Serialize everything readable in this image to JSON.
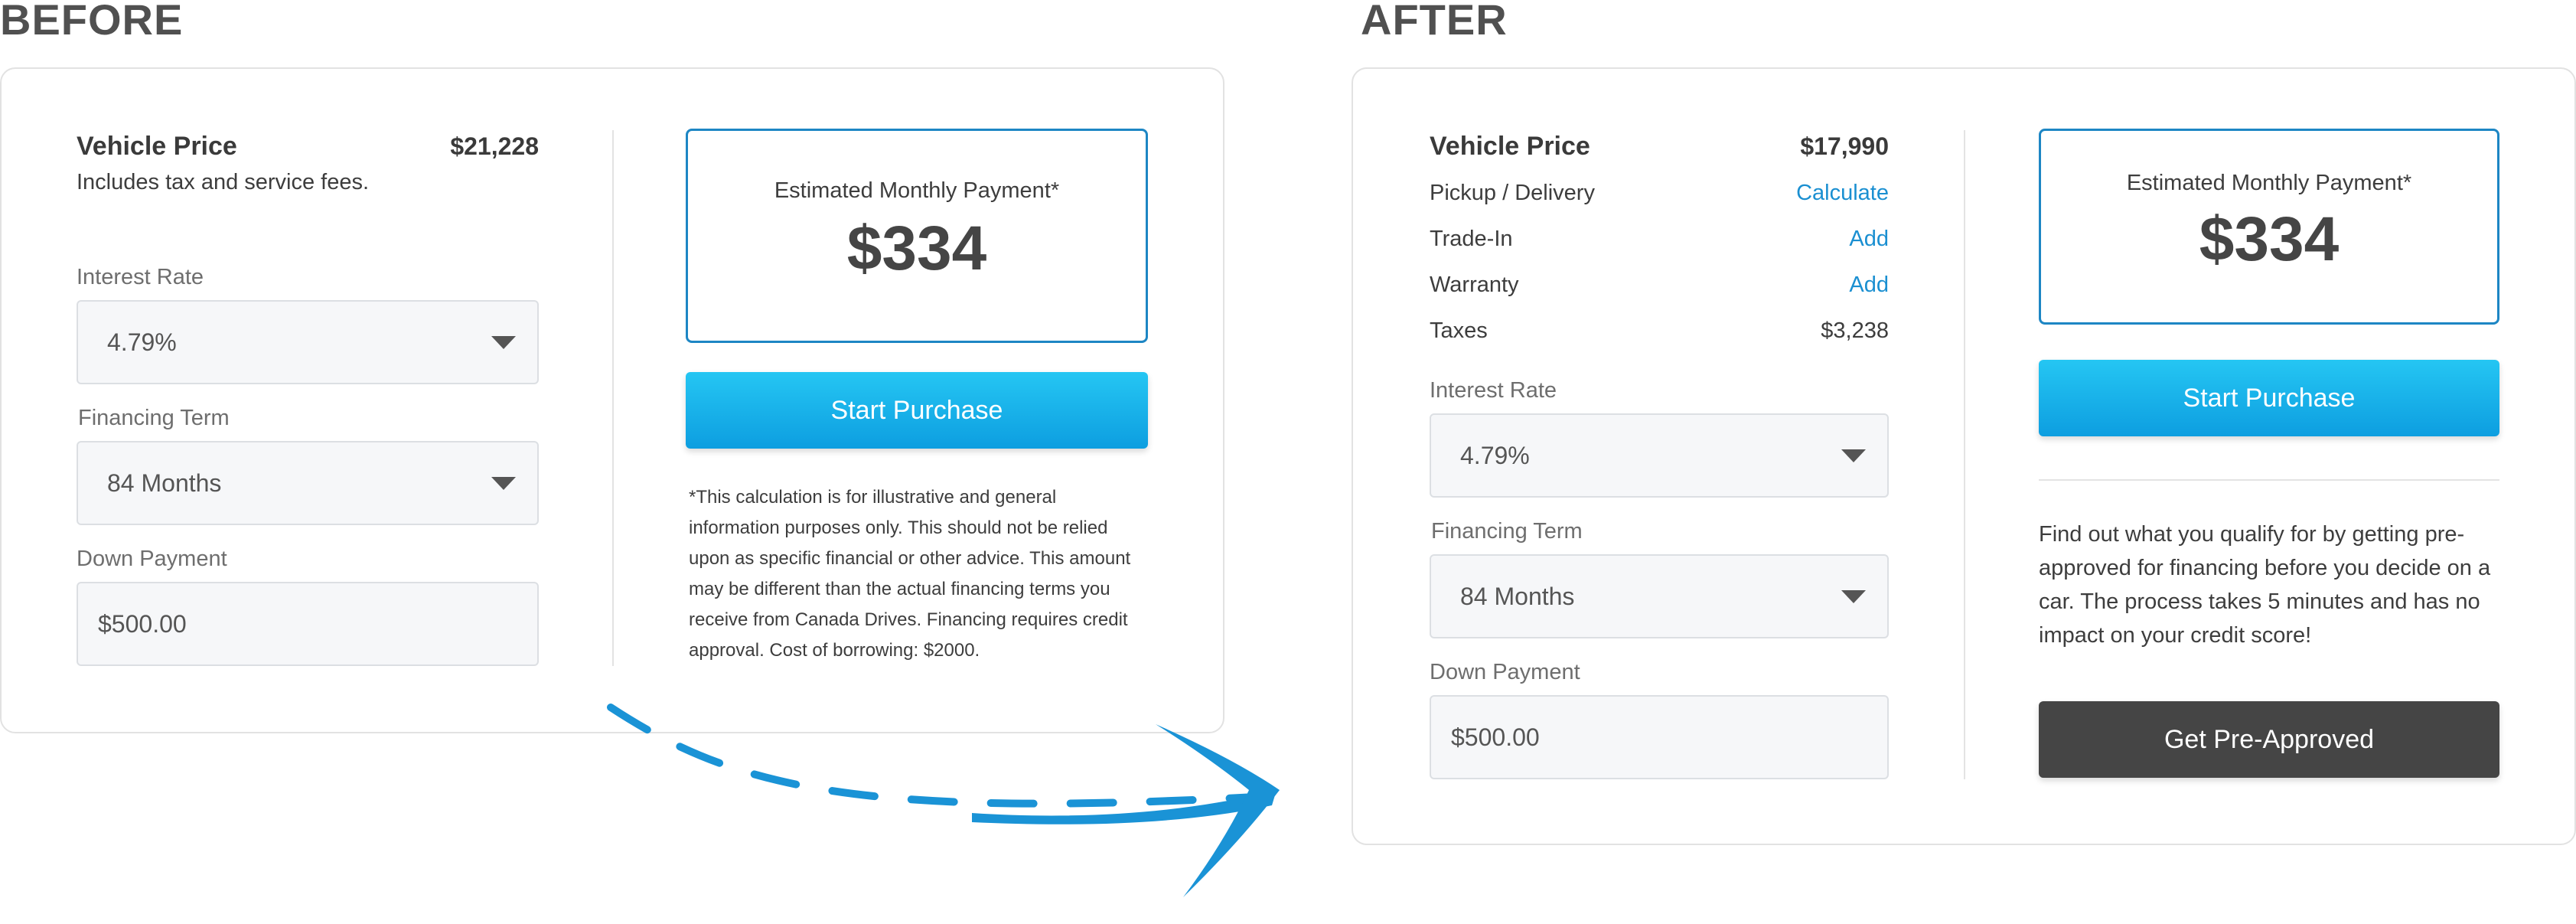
{
  "before": {
    "heading": "BEFORE",
    "vehicle_price_label": "Vehicle Price",
    "vehicle_price_value": "$21,228",
    "includes_note": "Includes tax and service fees.",
    "interest_rate_label": "Interest Rate",
    "interest_rate_value": "4.79%",
    "financing_term_label": "Financing Term",
    "financing_term_value": "84 Months",
    "down_payment_label": "Down Payment",
    "down_payment_value": "$500.00",
    "payment_label": "Estimated Monthly Payment*",
    "payment_amount": "$334",
    "start_button": "Start Purchase",
    "disclaimer": "*This calculation is for illustrative and general information purposes only. This should not be relied upon as specific financial or other advice. This amount may be different than the actual financing terms you receive from Canada Drives. Financing requires credit approval. Cost of borrowing: $2000."
  },
  "after": {
    "heading": "AFTER",
    "vehicle_price_label": "Vehicle Price",
    "vehicle_price_value": "$17,990",
    "pickup_label": "Pickup / Delivery",
    "pickup_link": "Calculate",
    "tradein_label": "Trade-In",
    "tradein_link": "Add",
    "warranty_label": "Warranty",
    "warranty_link": "Add",
    "taxes_label": "Taxes",
    "taxes_value": "$3,238",
    "interest_rate_label": "Interest Rate",
    "interest_rate_value": "4.79%",
    "financing_term_label": "Financing Term",
    "financing_term_value": "84 Months",
    "down_payment_label": "Down Payment",
    "down_payment_value": "$500.00",
    "payment_label": "Estimated Monthly Payment*",
    "payment_amount": "$334",
    "start_button": "Start Purchase",
    "promo_text": "Find out what you qualify for by getting pre-approved for financing before you decide on a car. The process takes 5 minutes and has no impact on your credit score!",
    "preapproved_button": "Get Pre-Approved"
  },
  "colors": {
    "accent_blue": "#1a8fd1",
    "button_gradient_top": "#25c6f3",
    "button_gradient_bottom": "#0d9ee0",
    "dark_button": "#454545",
    "arrow": "#1a93d6"
  },
  "icons": {
    "dropdown": "caret-down-icon",
    "transition": "curved-arrow-icon"
  }
}
